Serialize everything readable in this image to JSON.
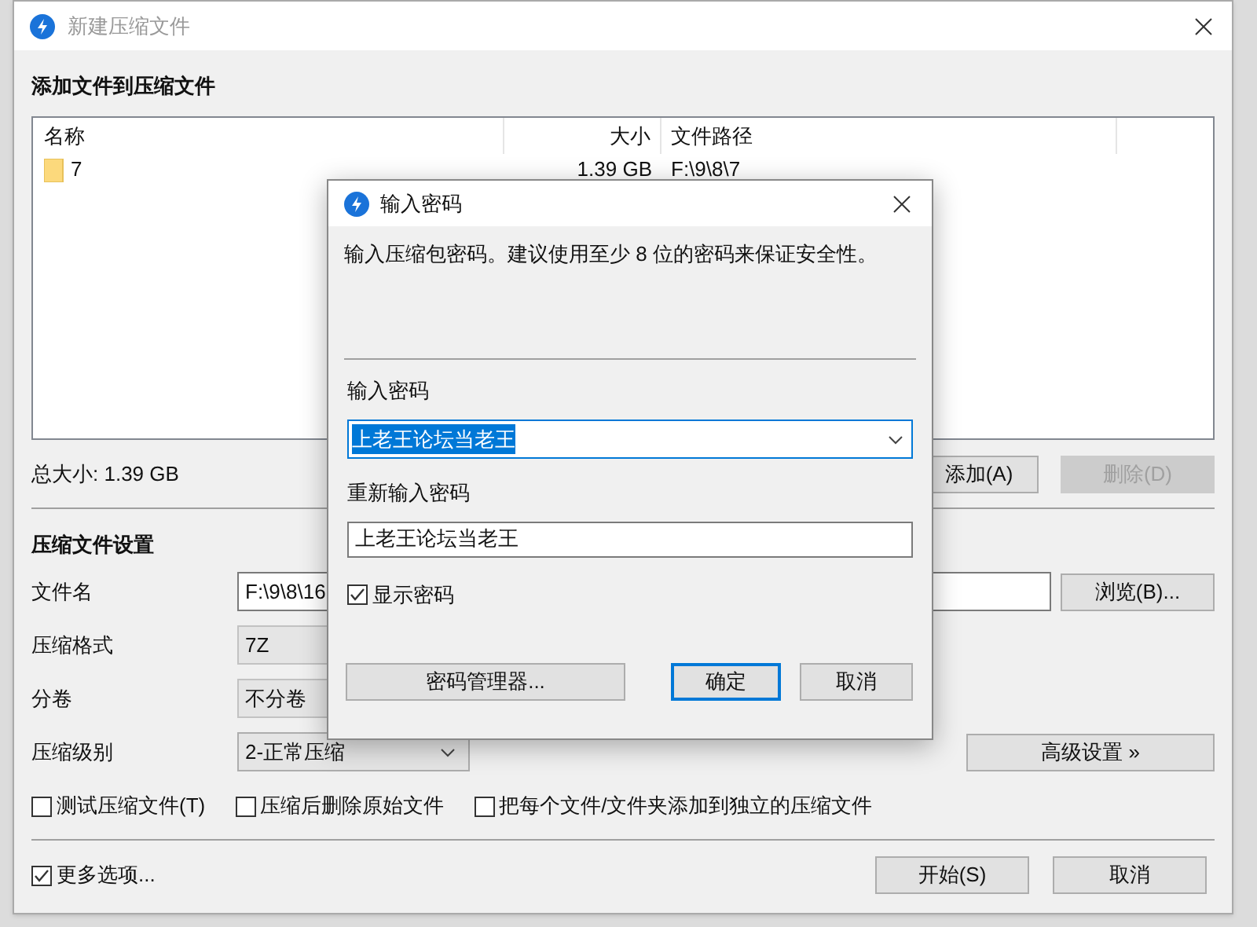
{
  "main_window": {
    "title": "新建压缩文件",
    "file_section": {
      "title": "添加文件到压缩文件",
      "columns": [
        "名称",
        "大小",
        "文件路径"
      ],
      "rows": [
        {
          "name": "7",
          "size": "1.39 GB",
          "path": "F:\\9\\8\\7"
        }
      ],
      "total": "总大小: 1.39 GB",
      "buttons": [
        {
          "label": "添加(A)",
          "disabled": false
        },
        {
          "label": "删除(D)",
          "disabled": true
        }
      ]
    },
    "settings": {
      "title": "压缩文件设置",
      "fields": [
        {
          "label": "文件名",
          "kind": "text",
          "value": "F:\\9\\8\\16",
          "button": "浏览(B)..."
        },
        {
          "label": "压缩格式",
          "kind": "combo",
          "value": "7Z"
        },
        {
          "label": "分卷",
          "kind": "combo",
          "value": "不分卷"
        },
        {
          "label": "压缩级别",
          "kind": "dropdown",
          "value": "2-正常压缩",
          "button": "高级设置 »"
        }
      ],
      "options": [
        {
          "label": "测试压缩文件(T)",
          "checked": false
        },
        {
          "label": "压缩后删除原始文件",
          "checked": false
        },
        {
          "label": "把每个文件/文件夹添加到独立的压缩文件",
          "checked": false
        }
      ]
    },
    "more_options": {
      "label": "更多选项...",
      "checked": true
    },
    "buttons": [
      "开始(S)",
      "取消"
    ]
  },
  "password_dialog": {
    "title": "输入密码",
    "hint": "输入压缩包密码。建议使用至少 8 位的密码来保证安全性。",
    "password_label": "输入密码",
    "password": "上老王论坛当老王",
    "password_selected": true,
    "confirm_label": "重新输入密码",
    "confirm": "上老王论坛当老王",
    "show_password": {
      "label": "显示密码",
      "checked": true
    },
    "buttons": [
      {
        "label": "密码管理器...",
        "default": false
      },
      {
        "label": "确定",
        "default": true
      },
      {
        "label": "取消",
        "default": false
      }
    ]
  }
}
